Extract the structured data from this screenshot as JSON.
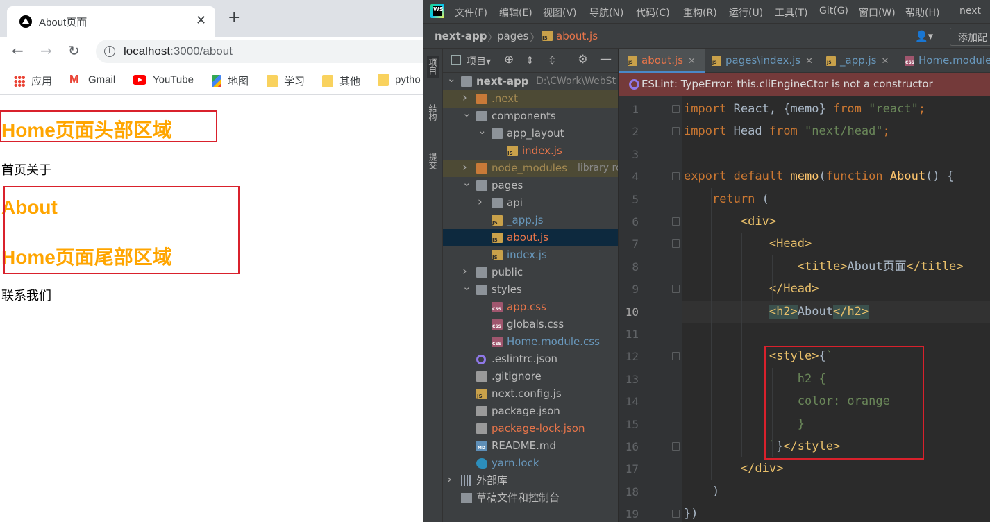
{
  "browser": {
    "tab_title": "About页面",
    "tab_close": "✕",
    "new_tab": "+",
    "url_host": "localhost",
    "url_rest": ":3000/about",
    "bookmarks": [
      {
        "label": "应用",
        "icon": "apps-icon"
      },
      {
        "label": "Gmail",
        "icon": "gmail-icon"
      },
      {
        "label": "YouTube",
        "icon": "youtube-icon"
      },
      {
        "label": "地图",
        "icon": "maps-icon"
      },
      {
        "label": "学习",
        "icon": "folder-icon"
      },
      {
        "label": "其他",
        "icon": "folder-icon"
      },
      {
        "label": "pytho",
        "icon": "folder-icon"
      }
    ],
    "page": {
      "header_heading": "Home页面头部区域",
      "nav_text": "首页关于",
      "about_heading": "About",
      "footer_heading": "Home页面尾部区域",
      "contact_text": "联系我们"
    },
    "heading_color": "#ffa500",
    "annotation_color": "#d9212c"
  },
  "ide": {
    "menu": [
      "文件(F)",
      "编辑(E)",
      "视图(V)",
      "导航(N)",
      "代码(C)",
      "重构(R)",
      "运行(U)",
      "工具(T)",
      "Git(G)",
      "窗口(W)",
      "帮助(H)",
      "next"
    ],
    "breadcrumbs": {
      "project": "next-app",
      "folder": "pages",
      "file": "about.js"
    },
    "add_config": "添加配",
    "side_tabs": [
      "项目",
      "结构",
      "提交"
    ],
    "project_panel_title": "项目",
    "tree": [
      {
        "name": "next-app",
        "path": "D:\\CWork\\WebSt",
        "kind": "folder",
        "color": "def",
        "arrow": "▾"
      },
      {
        "name": ".next",
        "kind": "folder-orange",
        "color": "dim",
        "arrow": "▸"
      },
      {
        "name": "components",
        "kind": "folder",
        "color": "def",
        "arrow": "▾"
      },
      {
        "name": "app_layout",
        "kind": "folder",
        "color": "def",
        "arrow": "▾"
      },
      {
        "name": "index.js",
        "kind": "js",
        "color": "red",
        "arrow": ""
      },
      {
        "name": "node_modules",
        "path": "library ro",
        "kind": "folder-orange",
        "color": "dim",
        "arrow": "▸"
      },
      {
        "name": "pages",
        "kind": "folder",
        "color": "def",
        "arrow": "▾"
      },
      {
        "name": "api",
        "kind": "folder",
        "color": "def",
        "arrow": "▸"
      },
      {
        "name": "_app.js",
        "kind": "js",
        "color": "blue",
        "arrow": ""
      },
      {
        "name": "about.js",
        "kind": "js",
        "color": "red",
        "arrow": ""
      },
      {
        "name": "index.js",
        "kind": "js",
        "color": "blue",
        "arrow": ""
      },
      {
        "name": "public",
        "kind": "folder",
        "color": "def",
        "arrow": "▸"
      },
      {
        "name": "styles",
        "kind": "folder",
        "color": "def",
        "arrow": "▾"
      },
      {
        "name": "app.css",
        "kind": "css",
        "color": "red",
        "arrow": ""
      },
      {
        "name": "globals.css",
        "kind": "css",
        "color": "def",
        "arrow": ""
      },
      {
        "name": "Home.module.css",
        "kind": "css",
        "color": "blue",
        "arrow": ""
      },
      {
        "name": ".eslintrc.json",
        "kind": "eslint",
        "color": "def",
        "arrow": ""
      },
      {
        "name": ".gitignore",
        "kind": "json",
        "color": "def",
        "arrow": ""
      },
      {
        "name": "next.config.js",
        "kind": "js",
        "color": "def",
        "arrow": ""
      },
      {
        "name": "package.json",
        "kind": "json",
        "color": "def",
        "arrow": ""
      },
      {
        "name": "package-lock.json",
        "kind": "json",
        "color": "red",
        "arrow": ""
      },
      {
        "name": "README.md",
        "kind": "md",
        "color": "def",
        "arrow": ""
      },
      {
        "name": "yarn.lock",
        "kind": "yarn",
        "color": "blue",
        "arrow": ""
      },
      {
        "name": "外部库",
        "kind": "lib",
        "color": "def",
        "arrow": "▸"
      },
      {
        "name": "草稿文件和控制台",
        "kind": "scratch",
        "color": "def",
        "arrow": ""
      }
    ],
    "editor_tabs": [
      {
        "label": "about.js",
        "icon": "js",
        "active": true
      },
      {
        "label": "pages\\index.js",
        "icon": "js",
        "active": false
      },
      {
        "label": "_app.js",
        "icon": "js",
        "active": false
      },
      {
        "label": "Home.module",
        "icon": "css",
        "active": false
      }
    ],
    "eslint_error": "ESLint: TypeError: this.cliEngineCtor is not a constructor",
    "current_line": 10,
    "lines": [
      {
        "n": "1",
        "html": "<span class=\"kw\">import</span> React, {memo} <span class=\"kw\">from</span> <span class=\"str\">\"react\"</span><span class=\"kw\">;</span>"
      },
      {
        "n": "2",
        "html": "<span class=\"kw\">import</span> Head <span class=\"kw\">from</span> <span class=\"str\">\"next/head\"</span><span class=\"kw\">;</span>"
      },
      {
        "n": "3",
        "html": ""
      },
      {
        "n": "4",
        "html": "<span class=\"kw\">export default</span> <span class=\"fn\">memo</span>(<span class=\"kw\">function</span> <span class=\"fn\">About</span>() {"
      },
      {
        "n": "5",
        "html": "    <span class=\"kw\">return</span> ("
      },
      {
        "n": "6",
        "html": "        <span class=\"tag\">&lt;div&gt;</span>"
      },
      {
        "n": "7",
        "html": "            <span class=\"tag\">&lt;Head&gt;</span>"
      },
      {
        "n": "8",
        "html": "                <span class=\"tag\">&lt;title&gt;</span>About页面<span class=\"tag\">&lt;/title&gt;</span>"
      },
      {
        "n": "9",
        "html": "            <span class=\"tag\">&lt;/Head&gt;</span>"
      },
      {
        "n": "10",
        "html": "            <span class=\"tag tagmatch\">&lt;h2&gt;</span>About<span class=\"tag tagmatch\">&lt;/h2&gt;</span>"
      },
      {
        "n": "11",
        "html": ""
      },
      {
        "n": "12",
        "html": "            <span class=\"tag\">&lt;style&gt;</span>{<span class=\"str\">`</span>"
      },
      {
        "n": "13",
        "html": "                <span class=\"cssc\">h2 {</span>"
      },
      {
        "n": "14",
        "html": "                <span class=\"cssc\">color: orange</span>"
      },
      {
        "n": "15",
        "html": "                <span class=\"cssc\">}</span>"
      },
      {
        "n": "16",
        "html": "            <span class=\"str\">`</span>}<span class=\"tag\">&lt;/style&gt;</span>"
      },
      {
        "n": "17",
        "html": "        <span class=\"tag\">&lt;/div&gt;</span>"
      },
      {
        "n": "18",
        "html": "    )"
      },
      {
        "n": "19",
        "html": "})"
      }
    ]
  }
}
